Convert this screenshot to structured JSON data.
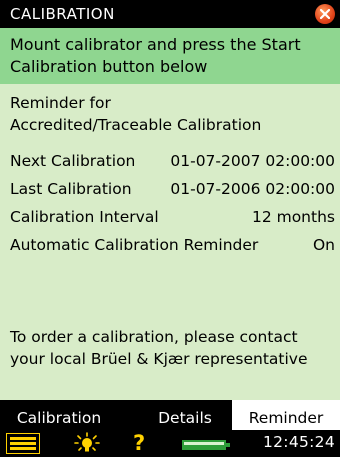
{
  "window": {
    "title": "CALIBRATION"
  },
  "instruction": "Mount calibrator and press the Start Calibration button below",
  "reminder": {
    "heading_line1": "Reminder for",
    "heading_line2": "Accredited/Traceable Calibration",
    "rows": [
      {
        "label": "Next Calibration",
        "value": "01-07-2007 02:00:00"
      },
      {
        "label": "Last Calibration",
        "value": "01-07-2006 02:00:00"
      },
      {
        "label": "Calibration Interval",
        "value": "12 months"
      },
      {
        "label": "Automatic Calibration Reminder",
        "value": "On"
      }
    ],
    "order_line1": "To order a calibration, please contact",
    "order_line2": "your local Brüel & Kjær representative"
  },
  "tabs": [
    {
      "label": "Calibration",
      "active": false
    },
    {
      "label": "Details",
      "active": false
    },
    {
      "label": "Reminder",
      "active": true
    }
  ],
  "statusbar": {
    "icons": [
      "menu-icon",
      "backlight-icon",
      "help-icon",
      "battery-icon"
    ],
    "time": "12:45:24"
  },
  "colors": {
    "title_bg": "#000000",
    "instruction_bg": "#8fd690",
    "content_bg": "#d8ecc8",
    "icon_yellow": "#ffd100",
    "battery_green": "#2e9e3a",
    "close_orange": "#e2431a"
  }
}
